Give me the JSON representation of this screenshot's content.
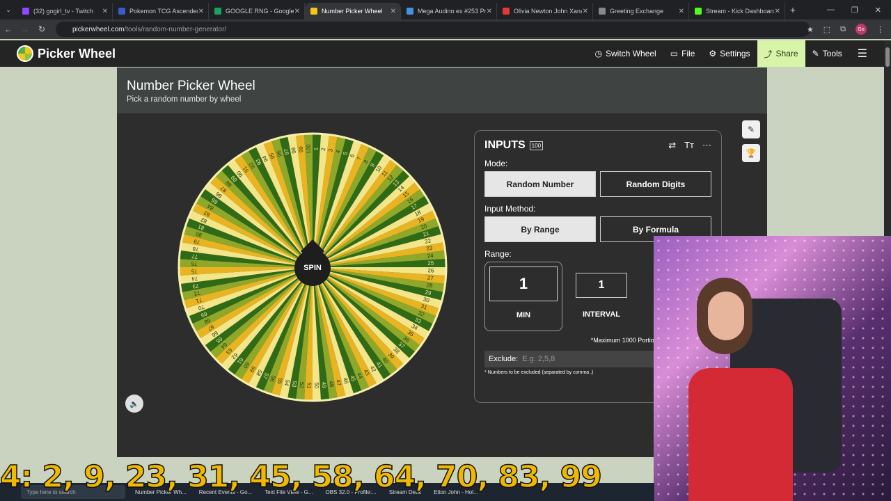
{
  "browser": {
    "tabs": [
      {
        "label": "(32) gogirl_tv - Twitch",
        "color": "#9146ff"
      },
      {
        "label": "Pokemon TCG Ascended H",
        "color": "#3a5bd0"
      },
      {
        "label": "GOOGLE RNG - Google Sh",
        "color": "#1aa260"
      },
      {
        "label": "Number Picker Wheel",
        "color": "#f5c518",
        "active": true
      },
      {
        "label": "Mega Audino ex #253 Pri",
        "color": "#4a90e2"
      },
      {
        "label": "Olivia Newton John Xana",
        "color": "#e53935"
      },
      {
        "label": "Greeting Exchange",
        "color": "#888888"
      },
      {
        "label": "Stream - Kick Dashboard",
        "color": "#53fc18"
      }
    ],
    "url_host": "pickerwheel.com",
    "url_path": "/tools/random-number-generator/",
    "profile_initials": "Go"
  },
  "site": {
    "logo_text": "Picker Wheel",
    "nav": [
      {
        "label": "Switch Wheel",
        "icon": "clock-icon"
      },
      {
        "label": "File",
        "icon": "folder-icon"
      },
      {
        "label": "Settings",
        "icon": "gear-icon"
      },
      {
        "label": "Share",
        "icon": "share-icon"
      },
      {
        "label": "Tools",
        "icon": "wrench-icon"
      }
    ]
  },
  "page": {
    "title": "Number Picker Wheel",
    "subtitle": "Pick a random number by wheel",
    "spin_label": "SPIN"
  },
  "wheel": {
    "numbers_start": 1,
    "numbers_end": 100,
    "colors": [
      "#2f6a16",
      "#f3e58a",
      "#e9b421",
      "#8fa82a"
    ]
  },
  "inputs": {
    "title": "INPUTS",
    "count": "100",
    "mode_label": "Mode:",
    "mode_options": [
      "Random Number",
      "Random Digits"
    ],
    "mode_selected": "Random Number",
    "method_label": "Input Method:",
    "method_options": [
      "By Range",
      "By Formula"
    ],
    "method_selected": "By Range",
    "range_label": "Range:",
    "min_value": "1",
    "min_caption": "MIN",
    "interval_value": "1",
    "interval_caption": "INTERVAL",
    "max_note": "*Maximum 1000 Portions",
    "exclude_label": "Exclude:",
    "exclude_placeholder": "E.g. 2,5,8",
    "exclude_note": "* Numbers to be excluded (separated by comma ,)"
  },
  "overlay": {
    "numbers_text": "4: 2, 9, 23, 31, 45, 58, 64, 70, 83, 99"
  },
  "taskbar": {
    "search_placeholder": "Type here to search",
    "items": [
      "Number Picker Wh...",
      "Recent Events - Go...",
      "Text File View - G...",
      "OBS 32.0 - Profile:...",
      "Stream Deck",
      "Elton John - Hol..."
    ]
  }
}
